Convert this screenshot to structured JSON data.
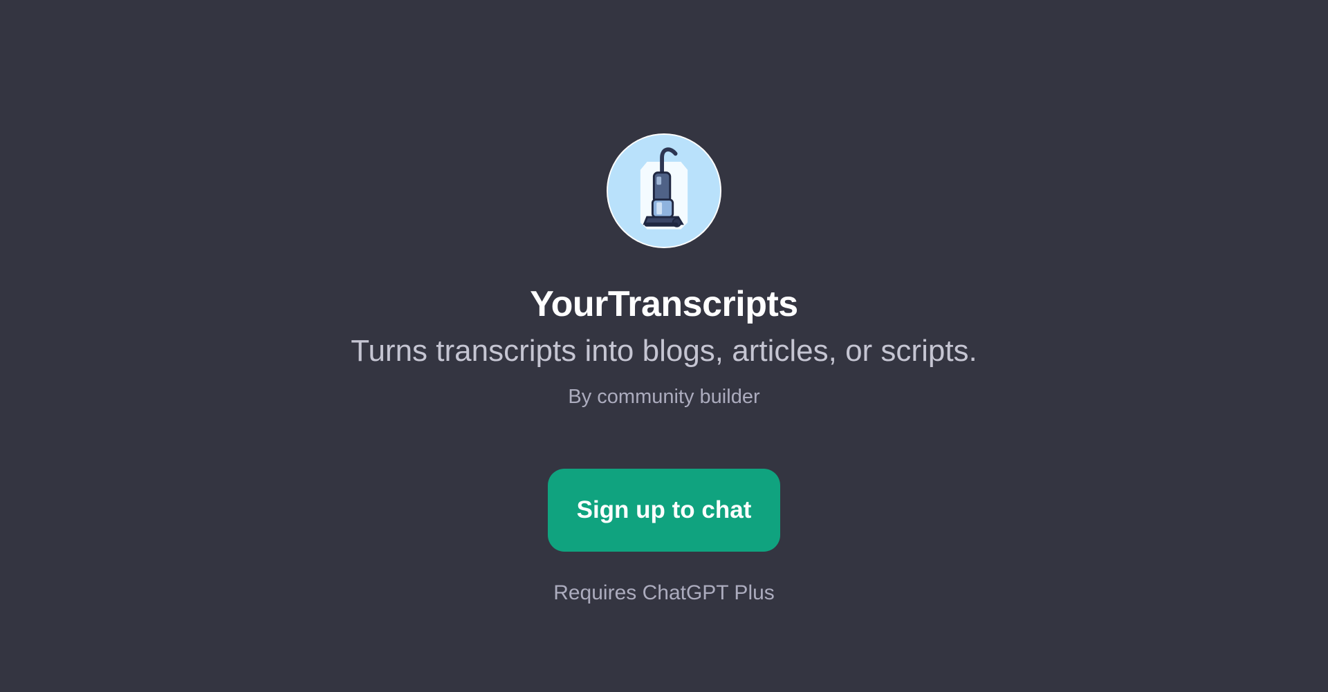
{
  "gpt": {
    "title": "YourTranscripts",
    "description": "Turns transcripts into blogs, articles, or scripts.",
    "byline": "By community builder",
    "avatar_icon": "vacuum-cleaner-icon"
  },
  "actions": {
    "signup_label": "Sign up to chat"
  },
  "footer": {
    "requirement": "Requires ChatGPT Plus"
  },
  "colors": {
    "background": "#343541",
    "accent": "#10a37f",
    "title": "#ffffff",
    "subtitle": "#c5c5d2",
    "muted": "#acacbe",
    "avatar_bg": "#cfe9fb"
  }
}
